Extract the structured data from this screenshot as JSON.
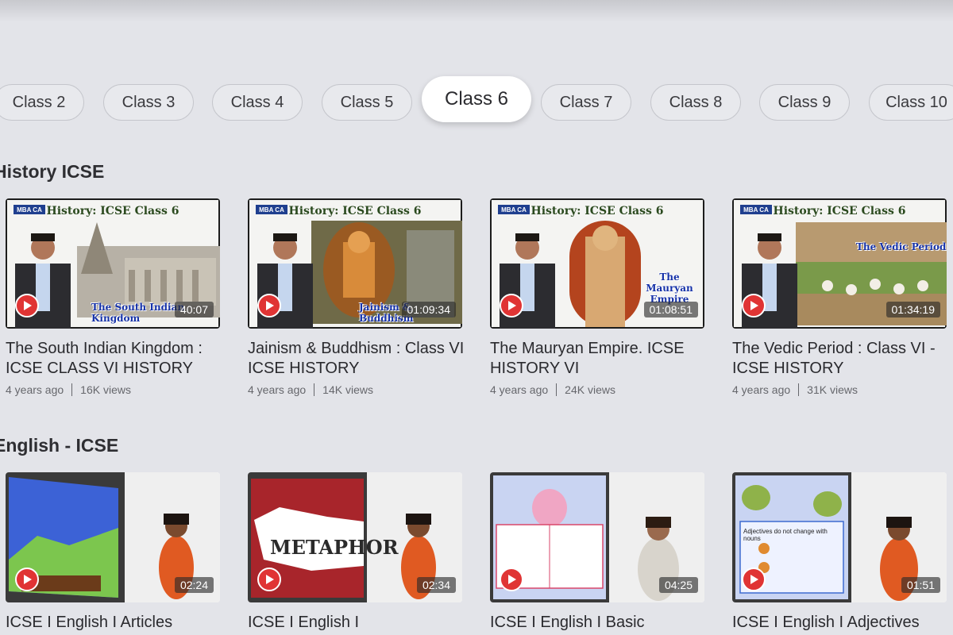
{
  "class_tabs": [
    "Class 2",
    "Class 3",
    "Class 4",
    "Class 5",
    "Class 6",
    "Class 7",
    "Class 8",
    "Class 9",
    "Class 10"
  ],
  "active_tab": "Class 6",
  "sections": [
    {
      "title": "History ICSE",
      "videos": [
        {
          "title": "The South Indian Kingdom : ICSE CLASS VI HISTORY",
          "age": "4 years ago",
          "views": "16K views",
          "duration": "40:07",
          "thumb_header": "History: ICSE Class 6",
          "thumb_caption": "The South Indian Kingdom"
        },
        {
          "title": "Jainism & Buddhism : Class VI ICSE HISTORY",
          "age": "4 years ago",
          "views": "14K views",
          "duration": "01:09:34",
          "thumb_header": "History: ICSE Class 6",
          "thumb_caption": "Jainism & Buddhism"
        },
        {
          "title": "The Mauryan Empire. ICSE HISTORY VI",
          "age": "4 years ago",
          "views": "24K views",
          "duration": "01:08:51",
          "thumb_header": "History: ICSE Class 6",
          "thumb_caption": "The Mauryan Empire"
        },
        {
          "title": "The Vedic Period : Class VI - ICSE HISTORY",
          "age": "4 years ago",
          "views": "31K views",
          "duration": "01:34:19",
          "thumb_header": "History: ICSE Class 6",
          "thumb_caption": "The Vedic Period"
        }
      ]
    },
    {
      "title": "English - ICSE",
      "videos": [
        {
          "title": "ICSE I English I Articles",
          "duration": "02:24"
        },
        {
          "title": "ICSE I English I",
          "duration": "02:34",
          "thumb_caption": "METAPHOR"
        },
        {
          "title": "ICSE I English I Basic",
          "duration": "04:25"
        },
        {
          "title": "ICSE I English I Adjectives",
          "duration": "01:51",
          "thumb_caption": "Adjectives do not change with nouns"
        }
      ]
    }
  ],
  "logo_text": "MBA CA",
  "colors": {
    "background": "#e3e4e9",
    "play_button": "#e03434",
    "active_chip": "#ffffff"
  }
}
